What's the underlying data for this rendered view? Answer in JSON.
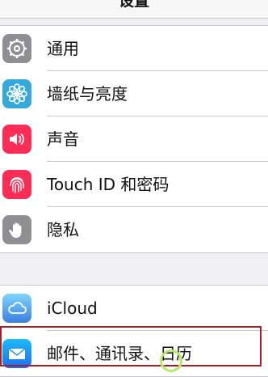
{
  "navbar": {
    "title": "设置"
  },
  "group1": {
    "items": [
      {
        "label": "通用",
        "icon": "gear-icon",
        "color": "#8e8e93"
      },
      {
        "label": "墙纸与亮度",
        "icon": "flower-icon",
        "color": "#34aadc"
      },
      {
        "label": "声音",
        "icon": "speaker-icon",
        "color": "#ff2d55"
      },
      {
        "label": "Touch ID 和密码",
        "icon": "fingerprint-icon",
        "color": "#ff2d55"
      },
      {
        "label": "隐私",
        "icon": "hand-icon",
        "color": "#8e8e93"
      }
    ]
  },
  "group2": {
    "items": [
      {
        "label": "iCloud",
        "icon": "cloud-icon",
        "color": "#5ac8fa"
      },
      {
        "label": "邮件、通讯录、日历",
        "icon": "mail-icon",
        "color": "#1a82fb"
      }
    ]
  },
  "highlight_color": "#a0202a"
}
